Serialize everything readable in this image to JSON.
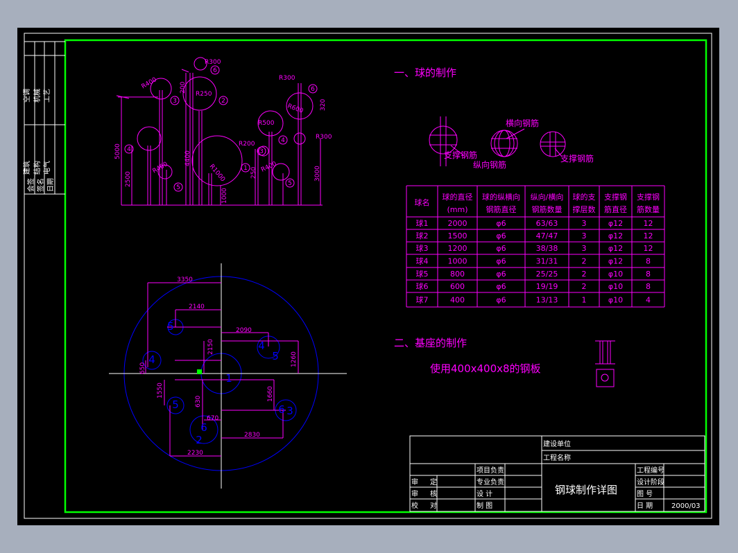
{
  "colors": {
    "background": "#a7afbd",
    "canvas": "#000000",
    "frame": "#ffffff",
    "border": "#00ff00",
    "drawing": "#ff00ff",
    "plan": "#0000ff",
    "axis": "#ffffff",
    "marker": "#00ff00"
  },
  "side_stamp": {
    "top_cells": [
      "空调",
      "机械",
      "工艺"
    ],
    "bottom_cells": [
      "建筑",
      "结构",
      "电气"
    ],
    "footer": [
      "会签",
      "签名",
      "日期"
    ]
  },
  "section1": {
    "title": "一、球的制作",
    "labels": {
      "transverse": "横向钢筋",
      "support": "支撑钢筋",
      "longitudinal": "纵向钢筋",
      "support2": "支撑钢筋"
    }
  },
  "elevation": {
    "labels": [
      "R300",
      "R250",
      "R400",
      "R300",
      "R600",
      "R500",
      "R200",
      "R400",
      "R1000",
      "R400",
      "R300"
    ],
    "dims": [
      "5000",
      "2500",
      "4400",
      "200",
      "1000",
      "250",
      "3000",
      "320"
    ],
    "balls": [
      "1",
      "2",
      "3",
      "4",
      "5",
      "6",
      "3",
      "4",
      "5",
      "6"
    ]
  },
  "table": {
    "headers": [
      [
        "球名",
        ""
      ],
      [
        "球的直径",
        "(mm)"
      ],
      [
        "球的纵横向",
        "钢筋直径"
      ],
      [
        "纵向/横向",
        "钢筋数量"
      ],
      [
        "球的支",
        "撑层数"
      ],
      [
        "支撑钢",
        "筋直径"
      ],
      [
        "支撑钢",
        "筋数量"
      ]
    ],
    "rows": [
      [
        "球1",
        "2000",
        "φ6",
        "63/63",
        "3",
        "φ12",
        "12"
      ],
      [
        "球2",
        "1500",
        "φ6",
        "47/47",
        "3",
        "φ12",
        "12"
      ],
      [
        "球3",
        "1200",
        "φ6",
        "38/38",
        "3",
        "φ12",
        "12"
      ],
      [
        "球4",
        "1000",
        "φ6",
        "31/31",
        "2",
        "φ12",
        "8"
      ],
      [
        "球5",
        "800",
        "φ6",
        "25/25",
        "2",
        "φ10",
        "8"
      ],
      [
        "球6",
        "600",
        "φ6",
        "19/19",
        "2",
        "φ10",
        "8"
      ],
      [
        "球7",
        "400",
        "φ6",
        "13/13",
        "1",
        "φ10",
        "4"
      ]
    ]
  },
  "section2": {
    "title": "二、基座的制作",
    "text": "使用400x400x8的钢板"
  },
  "plan": {
    "dims": [
      "3350",
      "2140",
      "2090",
      "2150",
      "1260",
      "650",
      "1550",
      "1660",
      "630",
      "670",
      "2830",
      "2230"
    ],
    "balls": [
      "5",
      "4",
      "1",
      "4",
      "5",
      "6",
      "3",
      "5",
      "6",
      "2"
    ]
  },
  "title_block": {
    "build_unit": "建设单位",
    "project_name": "工程名称",
    "drawing_title": "钢球制作详图",
    "left_rows": [
      [
        "审",
        "定"
      ],
      [
        "审",
        "核"
      ],
      [
        "校",
        "对"
      ]
    ],
    "mid_rows": [
      "项目负责",
      "专业负责",
      "设    计",
      "制    图"
    ],
    "right_rows": [
      [
        "工程编号",
        ""
      ],
      [
        "设计阶段",
        ""
      ],
      [
        "图    号",
        ""
      ],
      [
        "日    期",
        "2000/03"
      ]
    ]
  }
}
